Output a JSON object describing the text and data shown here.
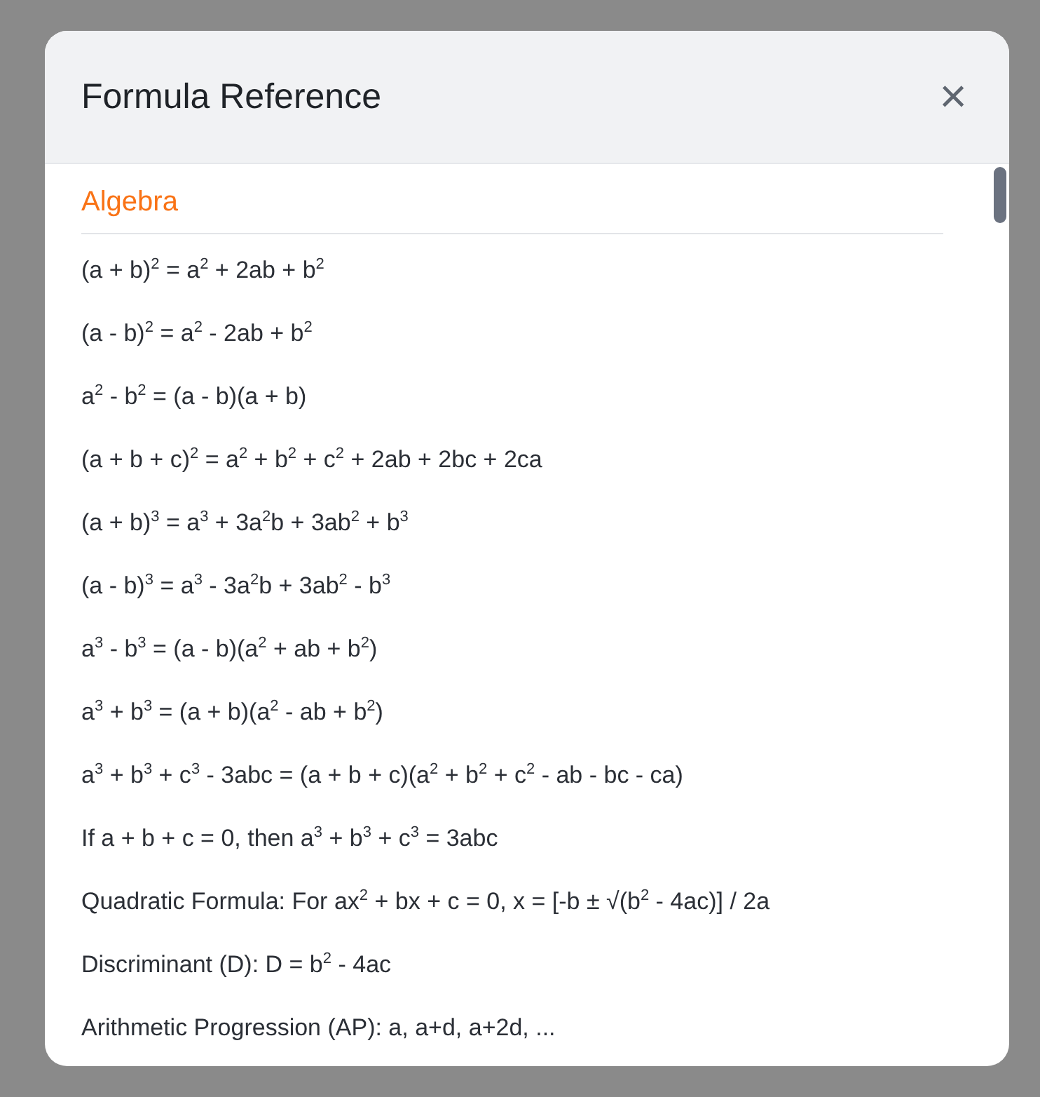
{
  "modal": {
    "title": "Formula Reference",
    "close_label": "×"
  },
  "sections": [
    {
      "heading": "Algebra",
      "formulas": [
        "(a + b)$^{2}$ = a$^{2}$ + 2ab + b$^{2}$",
        "(a - b)$^{2}$ = a$^{2}$ - 2ab + b$^{2}$",
        "a$^{2}$ - b$^{2}$ = (a - b)(a + b)",
        "(a + b + c)$^{2}$ = a$^{2}$ + b$^{2}$ + c$^{2}$ + 2ab + 2bc + 2ca",
        "(a + b)$^{3}$ = a$^{3}$ + 3a$^{2}$b + 3ab$^{2}$ + b$^{3}$",
        "(a - b)$^{3}$ = a$^{3}$ - 3a$^{2}$b + 3ab$^{2}$ - b$^{3}$",
        "a$^{3}$ - b$^{3}$ = (a - b)(a$^{2}$ + ab + b$^{2}$)",
        "a$^{3}$ + b$^{3}$ = (a + b)(a$^{2}$ - ab + b$^{2}$)",
        "a$^{3}$ + b$^{3}$ + c$^{3}$ - 3abc = (a + b + c)(a$^{2}$ + b$^{2}$ + c$^{2}$ - ab - bc - ca)",
        "If a + b + c = 0, then a$^{3}$ + b$^{3}$ + c$^{3}$ = 3abc",
        "Quadratic Formula: For ax$^{2}$ + bx + c = 0, x = [-b ± √(b$^{2}$ - 4ac)] / 2a",
        "Discriminant (D): D = b$^{2}$ - 4ac",
        "Arithmetic Progression (AP): a, a+d, a+2d, ..."
      ]
    }
  ]
}
